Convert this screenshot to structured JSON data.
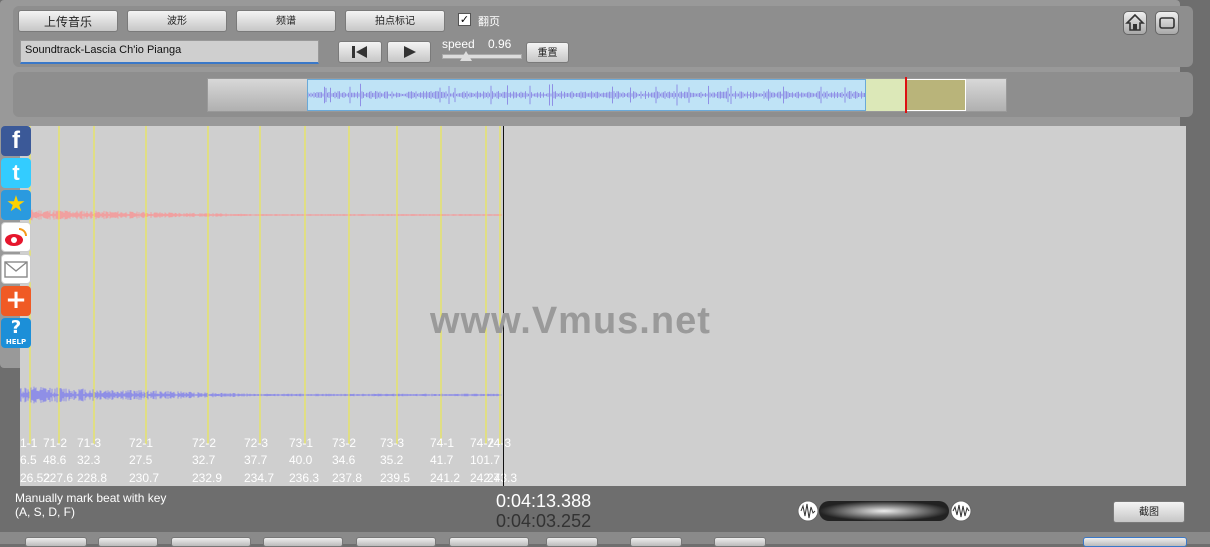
{
  "toolbar": {
    "upload_label": "上传音乐",
    "waveform_label": "波形",
    "spectrum_label": "频谱",
    "beat_mark_label": "拍点标记",
    "page_flip_label": "翻页",
    "page_flip_checked": true,
    "track_name": "Soundtrack-Lascia Ch'io Pianga",
    "speed_label": "speed",
    "speed_value": "0.96",
    "reset_label": "重置"
  },
  "watermark": "www.Vmus.net",
  "beat_markers": [
    {
      "label": "1-1",
      "val1": "6.5",
      "val2": "26.52"
    },
    {
      "label": "71-2",
      "val1": "48.6",
      "val2": "227.6"
    },
    {
      "label": "71-3",
      "val1": "32.3",
      "val2": "228.8"
    },
    {
      "label": "72-1",
      "val1": "27.5",
      "val2": "230.7"
    },
    {
      "label": "72-2",
      "val1": "32.7",
      "val2": "232.9"
    },
    {
      "label": "72-3",
      "val1": "37.7",
      "val2": "234.7"
    },
    {
      "label": "73-1",
      "val1": "40.0",
      "val2": "236.3"
    },
    {
      "label": "73-2",
      "val1": "34.6",
      "val2": "237.8"
    },
    {
      "label": "73-3",
      "val1": "35.2",
      "val2": "239.5"
    },
    {
      "label": "74-1",
      "val1": "41.7",
      "val2": "241.2"
    },
    {
      "label": "74-2",
      "val1": "101.7",
      "val2": "242.7"
    },
    {
      "label": "74-3",
      "val1": "",
      "val2": "243.3"
    }
  ],
  "status": {
    "line1": "Manually mark beat with key",
    "line2": "(A, S, D, F)"
  },
  "time": {
    "total": "0:04:13.388",
    "current": "0:04:03.252"
  },
  "screenshot_label": "截图",
  "social": [
    "facebook-icon",
    "twitter-icon",
    "favorite-star-icon",
    "weibo-icon",
    "email-icon",
    "add-share-icon",
    "help-icon"
  ],
  "social_help_text": "HELP",
  "colors": {
    "waveform_blue": "#8f8fe6",
    "waveform_red": "#f0a0a0",
    "marker_yellow": "#f2ee3a",
    "selection_blue": "#bfe3f6",
    "cursor_red": "#dd1111"
  }
}
